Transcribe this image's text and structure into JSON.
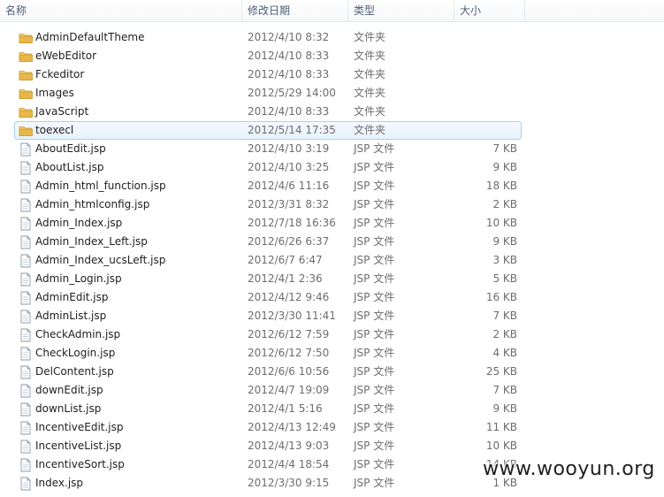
{
  "columns": {
    "name": "名称",
    "date": "修改日期",
    "type": "类型",
    "size": "大小"
  },
  "selected_index": 5,
  "files": [
    {
      "name": "AdminDefaultTheme",
      "date": "2012/4/10 8:32",
      "type": "文件夹",
      "size": "",
      "icon": "folder-icon"
    },
    {
      "name": "eWebEditor",
      "date": "2012/4/10 8:33",
      "type": "文件夹",
      "size": "",
      "icon": "folder-icon"
    },
    {
      "name": "Fckeditor",
      "date": "2012/4/10 8:33",
      "type": "文件夹",
      "size": "",
      "icon": "folder-icon"
    },
    {
      "name": "Images",
      "date": "2012/5/29 14:00",
      "type": "文件夹",
      "size": "",
      "icon": "folder-icon"
    },
    {
      "name": "JavaScript",
      "date": "2012/4/10 8:33",
      "type": "文件夹",
      "size": "",
      "icon": "folder-icon"
    },
    {
      "name": "toexecl",
      "date": "2012/5/14 17:35",
      "type": "文件夹",
      "size": "",
      "icon": "folder-icon"
    },
    {
      "name": "AboutEdit.jsp",
      "date": "2012/4/10 3:19",
      "type": "JSP 文件",
      "size": "7 KB",
      "icon": "file-icon"
    },
    {
      "name": "AboutList.jsp",
      "date": "2012/4/10 3:25",
      "type": "JSP 文件",
      "size": "9 KB",
      "icon": "file-icon"
    },
    {
      "name": "Admin_html_function.jsp",
      "date": "2012/4/6 11:16",
      "type": "JSP 文件",
      "size": "18 KB",
      "icon": "file-icon"
    },
    {
      "name": "Admin_htmlconfig.jsp",
      "date": "2012/3/31 8:32",
      "type": "JSP 文件",
      "size": "2 KB",
      "icon": "file-icon"
    },
    {
      "name": "Admin_Index.jsp",
      "date": "2012/7/18 16:36",
      "type": "JSP 文件",
      "size": "10 KB",
      "icon": "file-icon"
    },
    {
      "name": "Admin_Index_Left.jsp",
      "date": "2012/6/26 6:37",
      "type": "JSP 文件",
      "size": "9 KB",
      "icon": "file-icon"
    },
    {
      "name": "Admin_Index_ucsLeft.jsp",
      "date": "2012/6/7 6:47",
      "type": "JSP 文件",
      "size": "3 KB",
      "icon": "file-icon"
    },
    {
      "name": "Admin_Login.jsp",
      "date": "2012/4/1 2:36",
      "type": "JSP 文件",
      "size": "5 KB",
      "icon": "file-icon"
    },
    {
      "name": "AdminEdit.jsp",
      "date": "2012/4/12 9:46",
      "type": "JSP 文件",
      "size": "16 KB",
      "icon": "file-icon"
    },
    {
      "name": "AdminList.jsp",
      "date": "2012/3/30 11:41",
      "type": "JSP 文件",
      "size": "7 KB",
      "icon": "file-icon"
    },
    {
      "name": "CheckAdmin.jsp",
      "date": "2012/6/12 7:59",
      "type": "JSP 文件",
      "size": "2 KB",
      "icon": "file-icon"
    },
    {
      "name": "CheckLogin.jsp",
      "date": "2012/6/12 7:50",
      "type": "JSP 文件",
      "size": "4 KB",
      "icon": "file-icon"
    },
    {
      "name": "DelContent.jsp",
      "date": "2012/6/6 10:56",
      "type": "JSP 文件",
      "size": "25 KB",
      "icon": "file-icon"
    },
    {
      "name": "downEdit.jsp",
      "date": "2012/4/7 19:09",
      "type": "JSP 文件",
      "size": "7 KB",
      "icon": "file-icon"
    },
    {
      "name": "downList.jsp",
      "date": "2012/4/1 5:16",
      "type": "JSP 文件",
      "size": "9 KB",
      "icon": "file-icon"
    },
    {
      "name": "IncentiveEdit.jsp",
      "date": "2012/4/13 12:49",
      "type": "JSP 文件",
      "size": "11 KB",
      "icon": "file-icon"
    },
    {
      "name": "IncentiveList.jsp",
      "date": "2012/4/13 9:03",
      "type": "JSP 文件",
      "size": "10 KB",
      "icon": "file-icon"
    },
    {
      "name": "IncentiveSort.jsp",
      "date": "2012/4/4 18:54",
      "type": "JSP 文件",
      "size": "14 KB",
      "icon": "file-icon"
    },
    {
      "name": "Index.jsp",
      "date": "2012/3/30 9:15",
      "type": "JSP 文件",
      "size": "1 KB",
      "icon": "file-icon"
    }
  ],
  "watermark": "www.wooyun.org",
  "colors": {
    "folder": "#e8b64a",
    "selection_border": "#a9d1f0",
    "header_text": "#4c607a"
  }
}
